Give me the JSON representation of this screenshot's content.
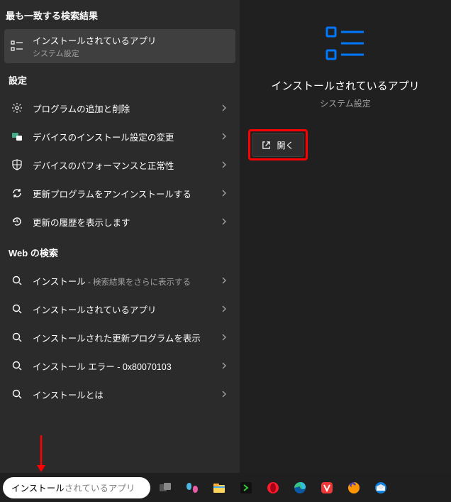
{
  "headers": {
    "top_match": "最も一致する検索結果",
    "settings": "設定",
    "web_search": "Web の検索"
  },
  "top_result": {
    "title": "インストールされているアプリ",
    "subtitle": "システム設定"
  },
  "settings_items": [
    {
      "title": "プログラムの追加と削除"
    },
    {
      "title": "デバイスのインストール設定の変更"
    },
    {
      "title": "デバイスのパフォーマンスと正常性"
    },
    {
      "title": "更新プログラムをアンインストールする"
    },
    {
      "title": "更新の履歴を表示します"
    }
  ],
  "web_items": [
    {
      "title": "インストール",
      "suffix": " - 検索結果をさらに表示する"
    },
    {
      "title": "インストールされているアプリ",
      "suffix": ""
    },
    {
      "title": "インストールされた更新プログラムを表示",
      "suffix": ""
    },
    {
      "title": "インストール エラー - 0x80070103",
      "suffix": ""
    },
    {
      "title": "インストールとは",
      "suffix": ""
    }
  ],
  "detail": {
    "title": "インストールされているアプリ",
    "subtitle": "システム設定",
    "open_label": "開く"
  },
  "search": {
    "value": "インストール",
    "placeholder_rest": "されているアプリ"
  }
}
